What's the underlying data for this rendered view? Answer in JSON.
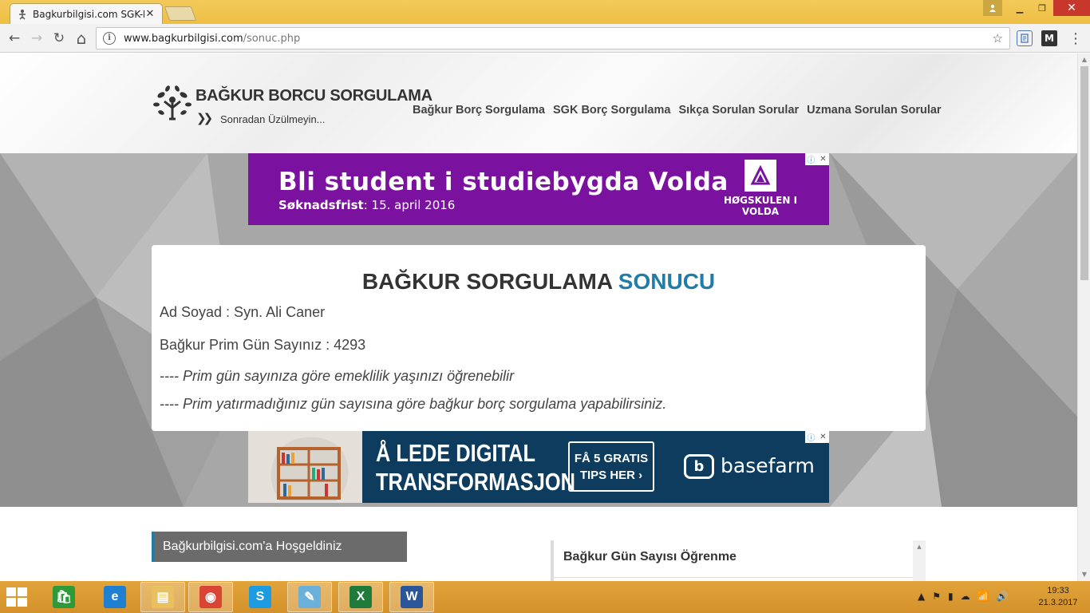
{
  "browser": {
    "tab_title": "Bagkurbilgisi.com SGK-B",
    "tab_close": "✕",
    "url_host": "www.bagkurbilgisi.com",
    "url_path": "/sonuc.php",
    "back_icon": "←",
    "forward_icon": "→",
    "reload_icon": "↻",
    "home_icon": "⌂",
    "star_icon": "☆",
    "menu_icon": "⋮",
    "ext2_label": "M",
    "win_min": "▁",
    "win_restore": "❐",
    "win_close": "✕"
  },
  "site": {
    "logo_title": "BAĞKUR BORCU SORGULAMA",
    "logo_chevrons": "❯❯",
    "logo_tagline": "Sonradan Üzülmeyin...",
    "nav": [
      {
        "label": "Bağkur Borç Sorgulama"
      },
      {
        "label": "SGK Borç Sorgulama"
      },
      {
        "label": "Sıkça Sorulan Sorular"
      },
      {
        "label": "Uzmana Sorulan Sorular"
      }
    ]
  },
  "ad_top": {
    "headline": "Bli student i studiebygda Volda",
    "sub_label": "Søknadsfrist",
    "sub_value": ": 15. april 2016",
    "brand_name": "HØGSKULEN I VOLDA",
    "choices_info": "ⓘ",
    "choices_close": "✕"
  },
  "result": {
    "title_main": "BAĞKUR SORGULAMA",
    "title_accent": "SONUCU",
    "name_line": "Ad Soyad : Syn. Ali Caner",
    "prim_line": "Bağkur Prim Gün Sayınız : 4293",
    "info_line_1": "---- Prim gün sayınıza göre emeklilik yaşınızı öğrenebilir",
    "info_line_2": "---- Prim yatırmadığınız gün sayısına göre bağkur borç sorgulama yapabilirsiniz."
  },
  "ad_bottom": {
    "headline_1": "Å LEDE DIGITAL",
    "headline_2": "TRANSFORMASJON",
    "cta_1": "FÅ 5 GRATIS",
    "cta_2": "TIPS HER ›",
    "brand_name": "basefarm",
    "choices_info": "ⓘ",
    "choices_close": "✕"
  },
  "below": {
    "welcome_title": "Bağkurbilgisi.com'a Hoşgeldiniz",
    "side_title": "Bağkur Gün Sayısı Öğrenme"
  },
  "taskbar": {
    "apps": [
      {
        "name": "store",
        "glyph": "🛍",
        "color": "#2e9a3a"
      },
      {
        "name": "internet-explorer",
        "glyph": "e",
        "color": "#1f7fd0"
      },
      {
        "name": "file-explorer",
        "glyph": "▤",
        "color": "#e8c060"
      },
      {
        "name": "chrome",
        "glyph": "◉",
        "color": "#d94535"
      },
      {
        "name": "skype",
        "glyph": "S",
        "color": "#1d9be0"
      },
      {
        "name": "notepad",
        "glyph": "✎",
        "color": "#6ab0d8"
      },
      {
        "name": "excel",
        "glyph": "X",
        "color": "#1f7a3c"
      },
      {
        "name": "word",
        "glyph": "W",
        "color": "#2a5699"
      }
    ],
    "tray_icons": [
      "▲",
      "⚑",
      "▮",
      "☁",
      "📶",
      "🔊"
    ],
    "time": "19:33",
    "date": "21.3.2017"
  },
  "colors": {
    "accent": "#1f7da8",
    "titlebar": "#f0c14b",
    "ad_purple": "#7a129f",
    "ad_navy": "#0e3c5f"
  }
}
